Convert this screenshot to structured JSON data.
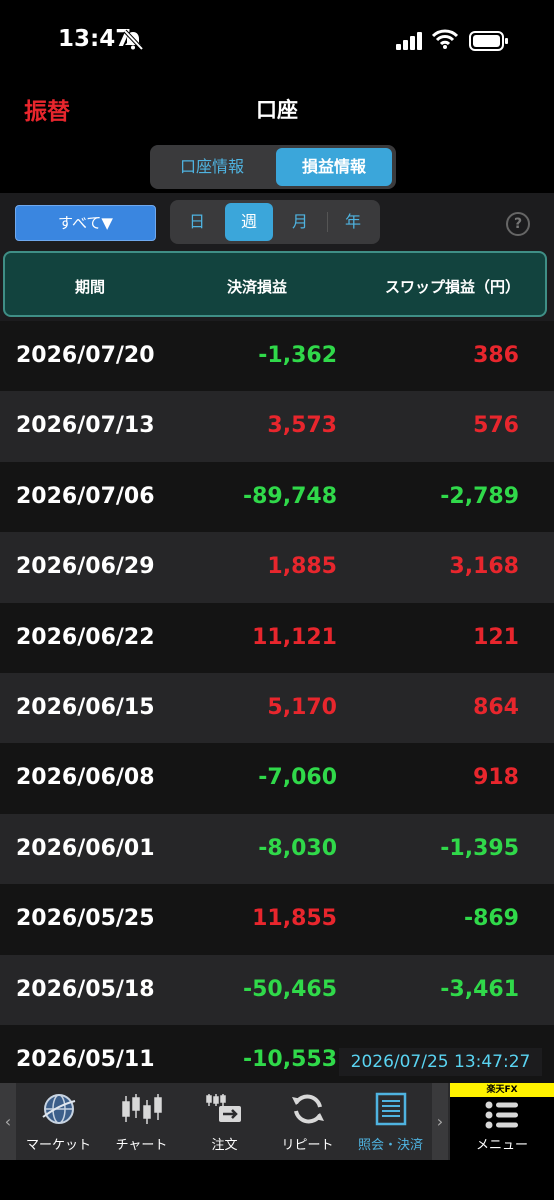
{
  "status": {
    "time": "13:47"
  },
  "nav": {
    "left_button": "振替",
    "title": "口座"
  },
  "segments": {
    "account_info": "口座情報",
    "pl_info": "損益情報"
  },
  "filter": {
    "label": "すべて▼"
  },
  "periods": {
    "day": "日",
    "week": "週",
    "month": "月",
    "year": "年",
    "selected": "週"
  },
  "help": {
    "label": "?"
  },
  "table": {
    "headers": {
      "period": "期間",
      "settlement": "決済損益",
      "swap": "スワップ損益（円）"
    },
    "rows": [
      {
        "date": "2026/07/20",
        "settlement": "-1,362",
        "swap": "386"
      },
      {
        "date": "2026/07/13",
        "settlement": "3,573",
        "swap": "576"
      },
      {
        "date": "2026/07/06",
        "settlement": "-89,748",
        "swap": "-2,789"
      },
      {
        "date": "2026/06/29",
        "settlement": "1,885",
        "swap": "3,168"
      },
      {
        "date": "2026/06/22",
        "settlement": "11,121",
        "swap": "121"
      },
      {
        "date": "2026/06/15",
        "settlement": "5,170",
        "swap": "864"
      },
      {
        "date": "2026/06/08",
        "settlement": "-7,060",
        "swap": "918"
      },
      {
        "date": "2026/06/01",
        "settlement": "-8,030",
        "swap": "-1,395"
      },
      {
        "date": "2026/05/25",
        "settlement": "11,855",
        "swap": "-869"
      },
      {
        "date": "2026/05/18",
        "settlement": "-50,465",
        "swap": "-3,461"
      },
      {
        "date": "2026/05/11",
        "settlement": "-10,553",
        "swap": ""
      }
    ]
  },
  "timestamp": "2026/07/25 13:47:27",
  "tabs": {
    "market": "マーケット",
    "chart": "チャート",
    "order": "注文",
    "repeat": "リピート",
    "inquiry": "照会・決済",
    "menu": "メニュー",
    "brand": "楽天FX"
  },
  "colors": {
    "positive": "#e8262d",
    "negative": "#30d94a",
    "accent": "#3ba6da"
  }
}
